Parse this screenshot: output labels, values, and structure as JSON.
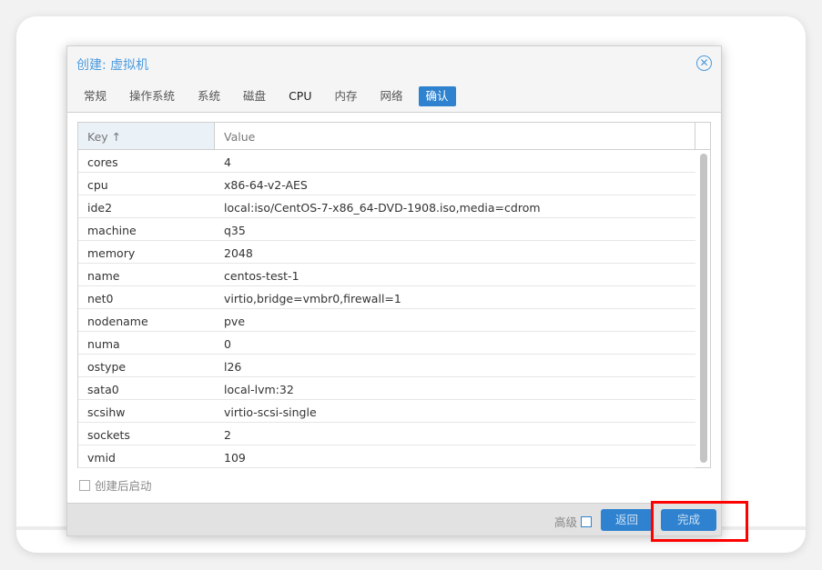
{
  "dialog": {
    "title": "创建: 虚拟机",
    "tabs": [
      {
        "label": "常规"
      },
      {
        "label": "操作系统"
      },
      {
        "label": "系统"
      },
      {
        "label": "磁盘"
      },
      {
        "label": "CPU"
      },
      {
        "label": "内存"
      },
      {
        "label": "网络"
      },
      {
        "label": "确认"
      }
    ],
    "active_tab": "确认",
    "grid": {
      "headers": {
        "key": "Key ↑",
        "value": "Value"
      },
      "rows": [
        [
          "cores",
          "4"
        ],
        [
          "cpu",
          "x86-64-v2-AES"
        ],
        [
          "ide2",
          "local:iso/CentOS-7-x86_64-DVD-1908.iso,media=cdrom"
        ],
        [
          "machine",
          "q35"
        ],
        [
          "memory",
          "2048"
        ],
        [
          "name",
          "centos-test-1"
        ],
        [
          "net0",
          "virtio,bridge=vmbr0,firewall=1"
        ],
        [
          "nodename",
          "pve"
        ],
        [
          "numa",
          "0"
        ],
        [
          "ostype",
          "l26"
        ],
        [
          "sata0",
          "local-lvm:32"
        ],
        [
          "scsihw",
          "virtio-scsi-single"
        ],
        [
          "sockets",
          "2"
        ],
        [
          "vmid",
          "109"
        ]
      ]
    },
    "start_after_create": {
      "label": "创建后启动",
      "checked": false
    },
    "footer": {
      "advanced_label": "高级",
      "advanced_checked": false,
      "back_label": "返回",
      "finish_label": "完成"
    }
  },
  "colors": {
    "accent": "#2f82cf",
    "highlight": "#ff0000"
  }
}
